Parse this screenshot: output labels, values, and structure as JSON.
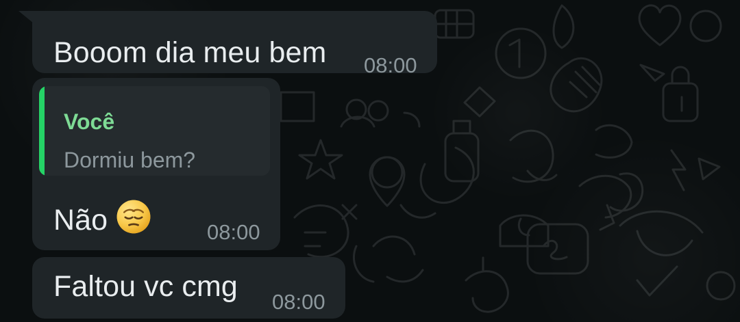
{
  "messages": [
    {
      "text": "Booom dia meu bem",
      "time": "08:00"
    },
    {
      "quote": {
        "author": "Você",
        "text": "Dormiu bem?"
      },
      "text": "Não",
      "emoji": "pensive-face",
      "time": "08:00"
    },
    {
      "text": "Faltou vc cmg",
      "time": "08:00"
    }
  ],
  "colors": {
    "background": "#0b0f10",
    "bubble": "#1f2528",
    "text": "#e9edef",
    "time": "#8d989d",
    "quote_bar": "#25d366",
    "quote_author": "#7edb95"
  }
}
